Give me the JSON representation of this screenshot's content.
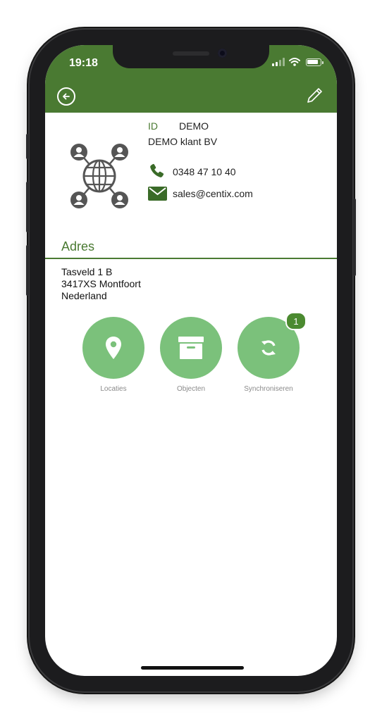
{
  "status_bar": {
    "time": "19:18"
  },
  "header": {
    "back_icon": "arrow-left-circle-icon",
    "edit_icon": "pencil-icon",
    "color": "#4a7a32"
  },
  "contact": {
    "id_label": "ID",
    "id_value": "DEMO",
    "company": "DEMO klant BV",
    "phone": "0348 47 10 40",
    "email": "sales@centix.com",
    "avatar_icon": "network-globe-icon"
  },
  "address": {
    "title": "Adres",
    "lines": [
      "Tasveld 1 B",
      "3417XS Montfoort",
      "Nederland"
    ]
  },
  "actions": [
    {
      "label": "Locaties",
      "icon": "map-pin-icon"
    },
    {
      "label": "Objecten",
      "icon": "archive-box-icon"
    },
    {
      "label": "Synchroniseren",
      "icon": "sync-icon",
      "badge": "1"
    }
  ],
  "colors": {
    "accent": "#4a7a32",
    "action_button": "#7bc17b",
    "badge": "#4b8a30"
  }
}
